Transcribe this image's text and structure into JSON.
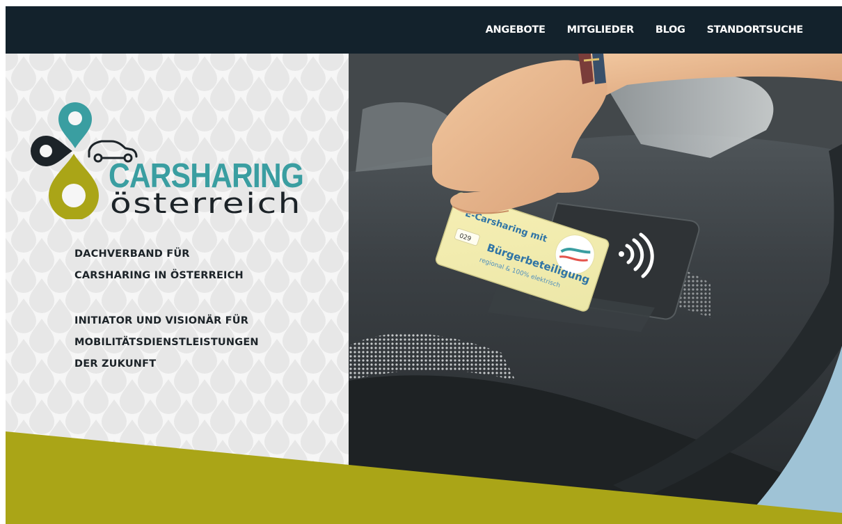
{
  "nav": {
    "items": [
      {
        "label": "ANGEBOTE"
      },
      {
        "label": "MITGLIEDER"
      },
      {
        "label": "BLOG"
      },
      {
        "label": "STANDORTSUCHE"
      }
    ]
  },
  "logo": {
    "brand_top": "CARSHARING",
    "brand_bottom": "österreich"
  },
  "hero": {
    "tagline_1": [
      "DACHVERBAND FÜR",
      "CARSHARING IN ÖSTERREICH"
    ],
    "tagline_2": [
      "INITIATOR UND VISIONÄR FÜR",
      "MOBILITÄTSDIENSTLEISTUNGEN",
      "DER ZUKUNFT"
    ]
  },
  "photo": {
    "card_line_1": "E-Carsharing mit",
    "card_line_2": "Bürgerbeteiligung",
    "card_line_3": "regional & 100% elektrisch",
    "card_number": "029"
  },
  "colors": {
    "nav_bg": "#13222c",
    "teal": "#3a9ea1",
    "olive": "#aaa517",
    "dark": "#1c2328",
    "pattern": "#e6e6e6"
  }
}
